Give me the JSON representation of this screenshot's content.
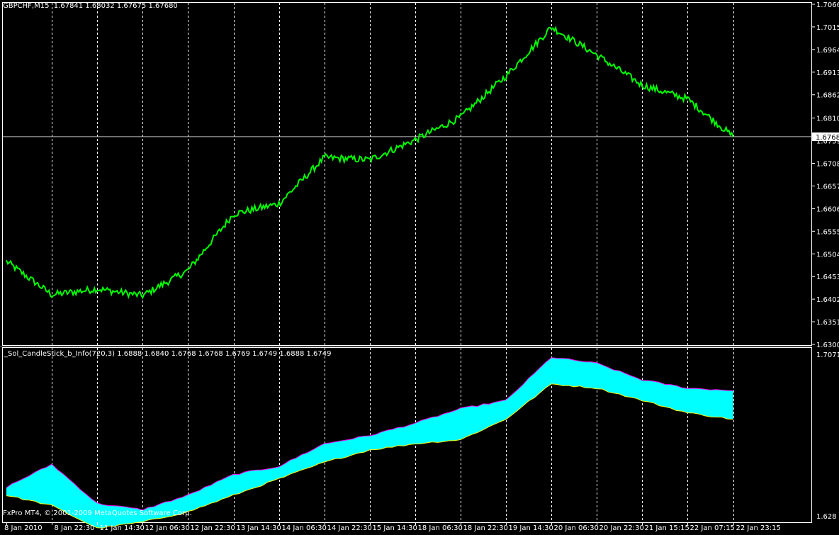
{
  "main_chart": {
    "symbol_label": "GBPCHF,M15",
    "ohlc": [
      "1.67841",
      "1.68032",
      "1.67675",
      "1.67680"
    ],
    "current_price": "1.67680",
    "price_axis": [
      "1.70665",
      "1.70155",
      "1.69645",
      "1.69135",
      "1.68625",
      "1.68100",
      "1.67590",
      "1.67080",
      "1.66570",
      "1.66060",
      "1.65550",
      "1.65040",
      "1.64530",
      "1.64020",
      "1.63510",
      "1.63000"
    ]
  },
  "indicator": {
    "name": "_Sol_CandleStick_b_Info(720,3)",
    "values": [
      "1.6888",
      "1.6840",
      "1.6768",
      "1.6768",
      "1.6769",
      "1.6749",
      "1.6888",
      "1.6749"
    ],
    "axis_top": "1.7071",
    "axis_bottom": "1.628"
  },
  "time_axis": [
    "8 Jan 2010",
    "8 Jan 22:30",
    "11 Jan 14:30",
    "12 Jan 06:30",
    "12 Jan 22:30",
    "13 Jan 14:30",
    "14 Jan 06:30",
    "14 Jan 22:30",
    "15 Jan 14:30",
    "18 Jan 06:30",
    "18 Jan 22:30",
    "19 Jan 14:30",
    "20 Jan 06:30",
    "20 Jan 22:30",
    "21 Jan 15:15",
    "22 Jan 07:15",
    "22 Jan 23:15"
  ],
  "footer": {
    "copyright": "FxPro MT4, © 2001-2009 MetaQuotes Software Corp."
  },
  "colors": {
    "background": "#000000",
    "price_line": "#00ff00",
    "grid": "#ffffff",
    "fill": "#00ffff",
    "upper_band": "#ff00ff",
    "lower_band": "#ffff00",
    "text": "#ffffff"
  },
  "chart_data": [
    {
      "type": "line",
      "series": [
        {
          "x": [
            "8 Jan 2010",
            "8 Jan 22:30",
            "11 Jan 14:30",
            "12 Jan 06:30",
            "12 Jan 22:30",
            "13 Jan 14:30",
            "14 Jan 06:30",
            "14 Jan 22:30",
            "15 Jan 14:30",
            "18 Jan 06:30",
            "18 Jan 22:30",
            "19 Jan 14:30",
            "20 Jan 06:30",
            "20 Jan 22:30",
            "21 Jan 15:15",
            "22 Jan 07:15",
            "22 Jan 23:15"
          ],
          "values": [
            1.6487,
            1.6412,
            1.6425,
            1.641,
            1.6467,
            1.6594,
            1.6617,
            1.6721,
            1.6716,
            1.6761,
            1.6812,
            1.6905,
            1.7015,
            1.6952,
            1.6884,
            1.6853,
            1.6768
          ]
        }
      ],
      "ylim": [
        1.63,
        1.70665
      ],
      "grid": true
    },
    {
      "type": "area",
      "series": [
        {
          "values": [
            1.642,
            1.653,
            1.634,
            1.631,
            1.638,
            1.648,
            1.652,
            1.663,
            1.667,
            1.673,
            1.68,
            1.684,
            1.705,
            1.702,
            1.694,
            1.69,
            1.6888
          ]
        },
        {
          "values": [
            1.638,
            1.633,
            1.622,
            1.625,
            1.63,
            1.638,
            1.646,
            1.654,
            1.66,
            1.663,
            1.665,
            1.675,
            1.692,
            1.69,
            1.684,
            1.678,
            1.6749
          ]
        }
      ],
      "ylim": [
        1.628,
        1.7071
      ],
      "grid": true
    }
  ]
}
